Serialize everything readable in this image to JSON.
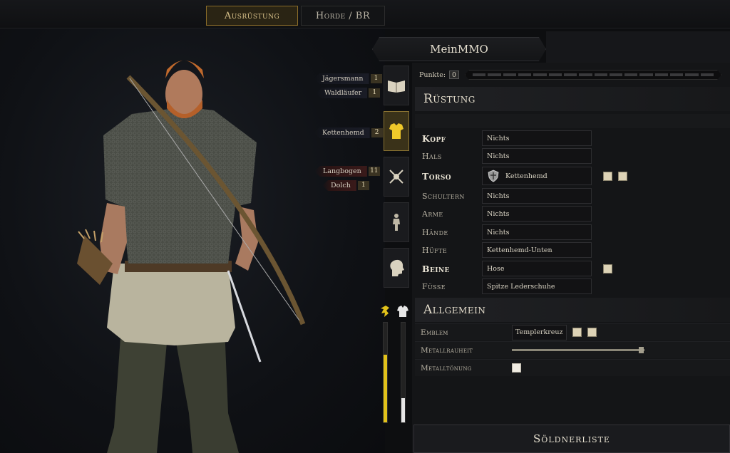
{
  "tabs": [
    {
      "label": "Ausrüstung",
      "active": true
    },
    {
      "label": "Horde / BR",
      "active": false
    }
  ],
  "character_name": "MeinMMO",
  "perks": [
    {
      "label": "Jägersmann",
      "level": "1",
      "color": "blue"
    },
    {
      "label": "Waldläufer",
      "level": "1",
      "color": "blue"
    },
    {
      "label": "Kettenhemd",
      "level": "2",
      "color": "blue"
    },
    {
      "label": "Langbogen",
      "level": "11",
      "color": "red"
    },
    {
      "label": "Dolch",
      "level": "1",
      "color": "red"
    }
  ],
  "categories": [
    {
      "name": "book-icon",
      "active": false
    },
    {
      "name": "armor-icon",
      "active": true
    },
    {
      "name": "crossed-swords-icon",
      "active": false
    },
    {
      "name": "figure-icon",
      "active": false
    },
    {
      "name": "head-icon",
      "active": false
    }
  ],
  "meters": {
    "speed_fraction": 0.68,
    "armor_fraction": 0.24,
    "speed_color": "#e2c21a",
    "armor_color": "#e6e6e6"
  },
  "points": {
    "label": "Punkte:",
    "value": "0",
    "slots": 16
  },
  "armor_section": {
    "title": "Rüstung",
    "slots": [
      {
        "key": "Kopf",
        "bold": true,
        "value": "Nichts"
      },
      {
        "key": "Hals",
        "bold": false,
        "value": "Nichts"
      },
      {
        "key": "Torso",
        "bold": true,
        "value": "Kettenhemd",
        "icon": "shield-crest-icon",
        "checkboxes": 2
      },
      {
        "key": "Schultern",
        "bold": false,
        "value": "Nichts"
      },
      {
        "key": "Arme",
        "bold": false,
        "value": "Nichts"
      },
      {
        "key": "Hände",
        "bold": false,
        "value": "Nichts"
      },
      {
        "key": "Hüfte",
        "bold": false,
        "value": "Kettenhemd-Unten"
      },
      {
        "key": "Beine",
        "bold": true,
        "value": "Hose",
        "checkboxes": 1
      },
      {
        "key": "Füsse",
        "bold": false,
        "value": "Spitze Lederschuhe"
      }
    ]
  },
  "general_section": {
    "title": "Allgemein",
    "emblem_label": "Emblem",
    "emblem_value": "Templerkreuz",
    "roughness_label": "Metallrauheit",
    "roughness_value": 0.98,
    "tint_label": "Metalltönung"
  },
  "bottom_button": "Söldnerliste"
}
